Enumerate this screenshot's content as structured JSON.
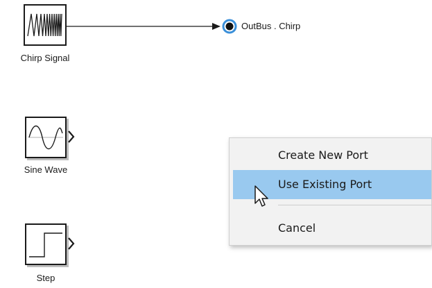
{
  "canvas": {
    "blocks": [
      {
        "name": "Chirp Signal",
        "icon": "chirp-wave-icon"
      },
      {
        "name": "Sine Wave",
        "icon": "sine-wave-icon"
      },
      {
        "name": "Step",
        "icon": "step-function-icon"
      }
    ],
    "connection": {
      "source": "Chirp Signal",
      "target_label": "OutBus . Chirp",
      "highlight_color": "#3a8fd9"
    }
  },
  "context_menu": {
    "items": [
      {
        "label": "Create New Port",
        "selected": false
      },
      {
        "label": "Use Existing Port",
        "selected": true
      },
      {
        "label": "Cancel",
        "selected": false
      }
    ],
    "selected_color": "#99c9ef"
  }
}
